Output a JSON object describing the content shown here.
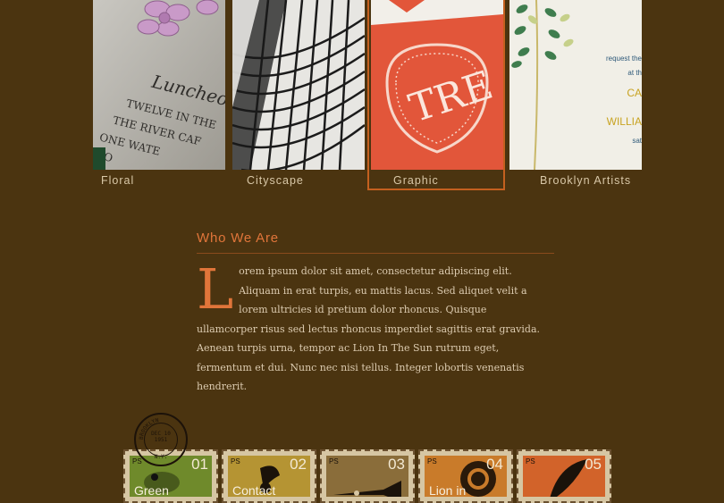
{
  "gallery": {
    "tiles": [
      {
        "label": "Floral"
      },
      {
        "label": "Cityscape"
      },
      {
        "label": "Graphic",
        "selected": true
      },
      {
        "label": "Brooklyn Artists"
      }
    ],
    "floral_print": [
      "Luncheo",
      "TWELVE IN THE",
      "THE RIVER CAF",
      "ONE WATE",
      "BRO"
    ],
    "graphic_monogram": "TRE",
    "brooklyn_print": [
      "request the",
      "at th",
      "CA",
      "WILLIA",
      "sat"
    ]
  },
  "about": {
    "title": "Who We Are",
    "dropcap": "L",
    "body": "orem ipsum dolor sit amet, consectetur adipiscing elit. Aliquam in erat turpis, eu mattis lacus. Sed aliquet velit a lorem ultricies id pretium dolor rhoncus. Quisque ullamcorper risus sed lectus rhoncus imperdiet sagittis erat gravida. Aenean turpis urna, tempor ac Lion In The Sun rutrum eget, fermentum et dui. Nunc nec nisi tellus. Integer lobortis venenatis hendrerit."
  },
  "postmark": {
    "top": "BROOKLYN",
    "middle": "DEC 10",
    "year": "1951",
    "bottom": "N.Y."
  },
  "stamps": [
    {
      "ps": "PS",
      "number": "01",
      "label": "Green",
      "color": "#6f8a2b",
      "icon": "frog-icon"
    },
    {
      "ps": "PS",
      "number": "02",
      "label": "Contact",
      "color": "#b59433",
      "icon": "phonograph-icon"
    },
    {
      "ps": "PS",
      "number": "03",
      "label": "",
      "color": "#8a6d3a",
      "icon": "trumpet-icon"
    },
    {
      "ps": "PS",
      "number": "04",
      "label": "Lion in",
      "color": "#c97b2a",
      "icon": "lion-icon"
    },
    {
      "ps": "PS",
      "number": "05",
      "label": "",
      "color": "#d2632a",
      "icon": "quill-icon"
    }
  ],
  "colors": {
    "background": "#4b3410",
    "accent": "#e0753a",
    "text": "#dccbb0"
  }
}
